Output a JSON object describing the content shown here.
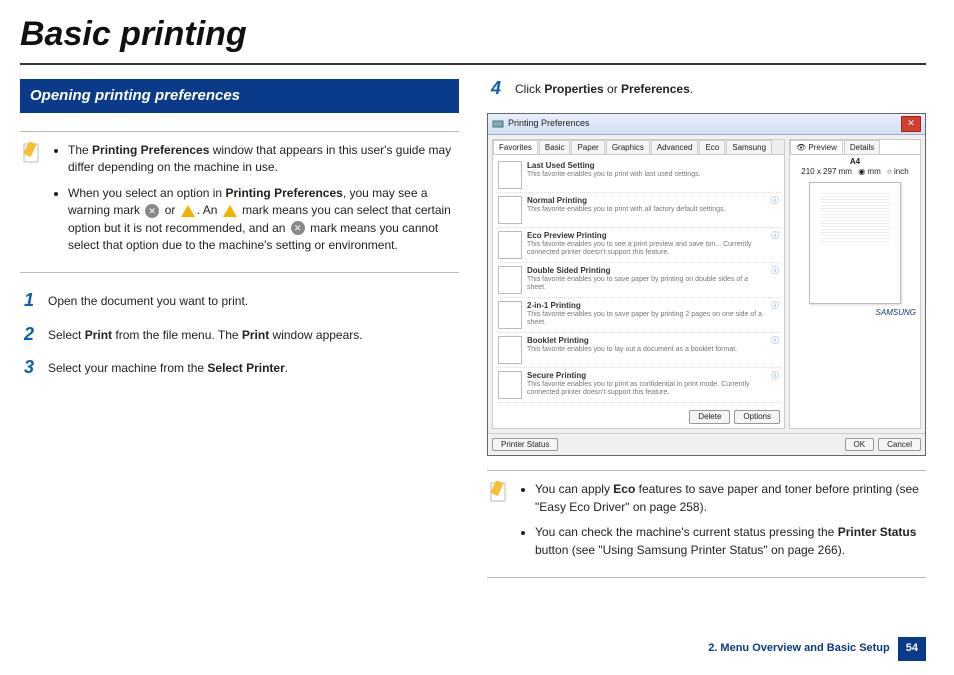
{
  "page_title": "Basic printing",
  "section_heading": "Opening printing preferences",
  "noteA": {
    "li1_pre": "The ",
    "li1_bold": "Printing Preferences",
    "li1_post": " window that appears in this user's guide may differ depending on the machine in use.",
    "li2_pre": "When you select an option in ",
    "li2_bold": "Printing Preferences",
    "li2_mid": ", you may see a warning mark ",
    "li2_mid2": " or ",
    "li2_mid3": ". An ",
    "li2_mid4": " mark means you can select that certain option but it is not recommended, and an ",
    "li2_post": " mark means you cannot select that option due to the machine's setting or environment."
  },
  "steps": {
    "s1_num": "1",
    "s1_body": "Open the document you want to print.",
    "s2_num": "2",
    "s2_pre": "Select ",
    "s2_b1": "Print",
    "s2_mid": " from the file menu. The ",
    "s2_b2": "Print",
    "s2_post": " window appears.",
    "s3_num": "3",
    "s3_pre": "Select your machine from the ",
    "s3_b": "Select Printer",
    "s3_post": ".",
    "s4_num": "4",
    "s4_pre": "Click ",
    "s4_b1": "Properties",
    "s4_mid": " or ",
    "s4_b2": "Preferences",
    "s4_post": "."
  },
  "dialog": {
    "title": "Printing Preferences",
    "tabs": [
      "Favorites",
      "Basic",
      "Paper",
      "Graphics",
      "Advanced",
      "Eco",
      "Samsung"
    ],
    "favs": [
      {
        "t": "Last Used Setting",
        "d": "This favorite enables you to print with last used settings."
      },
      {
        "t": "Normal Printing",
        "d": "This favorite enables you to print with all factory default settings."
      },
      {
        "t": "Eco Preview Printing",
        "d": "This favorite enables you to see a print preview and save ton... Currently connected printer doesn't support this feature."
      },
      {
        "t": "Double Sided Printing",
        "d": "This favorite enables you to save paper by printing on double sides of a sheet."
      },
      {
        "t": "2-in-1 Printing",
        "d": "This favorite enables you to save paper by printing 2 pages on one side of a sheet."
      },
      {
        "t": "Booklet Printing",
        "d": "This favorite enables you to lay out a document as a booklet format."
      },
      {
        "t": "Secure Printing",
        "d": "This favorite enables you to print as confidential in print mode. Currently connected printer doesn't support this feature."
      }
    ],
    "btn_delete": "Delete",
    "btn_options": "Options",
    "rtabs": {
      "preview": "Preview",
      "details": "Details"
    },
    "paper": "A4",
    "paper_size": "210 x 297 mm",
    "unit_mm": "mm",
    "unit_inch": "inch",
    "printer_status": "Printer Status",
    "ok": "OK",
    "cancel": "Cancel",
    "logo": "SAMSUNG"
  },
  "noteB": {
    "li1_pre": "You can apply ",
    "li1_b": "Eco",
    "li1_mid": " features to save paper and toner before printing (see ",
    "li1_link": "\"Easy Eco Driver\" on page 258",
    "li1_post": ").",
    "li2_pre": "You can check the machine's current status pressing the ",
    "li2_b": "Printer Status",
    "li2_mid": " button (see ",
    "li2_link": "\"Using Samsung Printer Status\" on page 266",
    "li2_post": ")."
  },
  "footer": {
    "chapter": "2. Menu Overview and Basic Setup",
    "page": "54"
  }
}
